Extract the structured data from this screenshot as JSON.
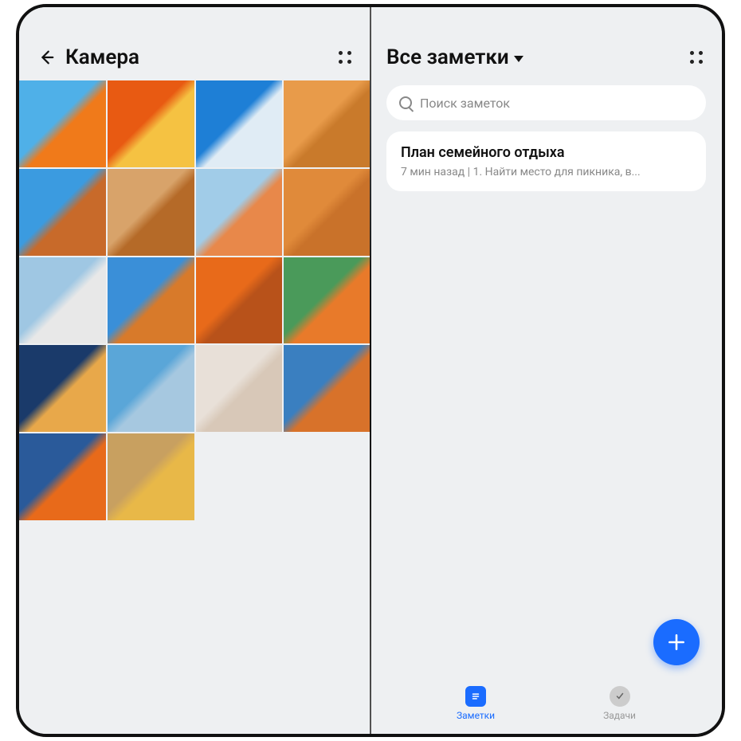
{
  "left_pane": {
    "title": "Камера",
    "thumbnails": [
      {
        "id": 0,
        "colors": [
          "#4FB0E8",
          "#F07A1A"
        ],
        "name": "photo-paper-boat"
      },
      {
        "id": 1,
        "colors": [
          "#E85A12",
          "#F5C242"
        ],
        "name": "photo-hat-popsicle"
      },
      {
        "id": 2,
        "colors": [
          "#1E7FD6",
          "#E0ECF5"
        ],
        "name": "photo-skier"
      },
      {
        "id": 3,
        "colors": [
          "#E89B4A",
          "#C97A2B"
        ],
        "name": "photo-desert-camels"
      },
      {
        "id": 4,
        "colors": [
          "#3B9BE0",
          "#C86A2A"
        ],
        "name": "photo-colorful-houses"
      },
      {
        "id": 5,
        "colors": [
          "#D8A36A",
          "#B56A28"
        ],
        "name": "photo-canyon-arch"
      },
      {
        "id": 6,
        "colors": [
          "#A1CCE8",
          "#E8884A"
        ],
        "name": "photo-beach-chairs"
      },
      {
        "id": 7,
        "colors": [
          "#E08A3A",
          "#C9722A"
        ],
        "name": "photo-sand-dunes"
      },
      {
        "id": 8,
        "colors": [
          "#9FC7E3",
          "#E8E8E8"
        ],
        "name": "photo-snowy-mountains"
      },
      {
        "id": 9,
        "colors": [
          "#3A8FD8",
          "#D87A2A"
        ],
        "name": "photo-road-highway"
      },
      {
        "id": 10,
        "colors": [
          "#E86A1A",
          "#B8521A"
        ],
        "name": "photo-orange-tent"
      },
      {
        "id": 11,
        "colors": [
          "#4A9A5A",
          "#E87A2A"
        ],
        "name": "photo-camping-field"
      },
      {
        "id": 12,
        "colors": [
          "#1A3A6A",
          "#E8A84A"
        ],
        "name": "photo-lanterns"
      },
      {
        "id": 13,
        "colors": [
          "#5AA6D8",
          "#A6C8E0"
        ],
        "name": "photo-straight-road"
      },
      {
        "id": 14,
        "colors": [
          "#E8E0D8",
          "#D8C8B8"
        ],
        "name": "photo-woman-sweater"
      },
      {
        "id": 15,
        "colors": [
          "#3A7FC0",
          "#D8722A"
        ],
        "name": "photo-pagoda"
      },
      {
        "id": 16,
        "colors": [
          "#2A5A9A",
          "#E86A1A"
        ],
        "name": "photo-bridge-sunset"
      },
      {
        "id": 17,
        "colors": [
          "#C8A060",
          "#E8B848"
        ],
        "name": "photo-woman-guitar"
      }
    ]
  },
  "right_pane": {
    "title": "Все заметки",
    "search_placeholder": "Поиск заметок",
    "notes": [
      {
        "title": "План семейного отдыха",
        "subtitle": "7 мин назад  |  1. Найти место для пикника, в..."
      }
    ],
    "nav": {
      "notes_label": "Заметки",
      "tasks_label": "Задачи"
    }
  }
}
